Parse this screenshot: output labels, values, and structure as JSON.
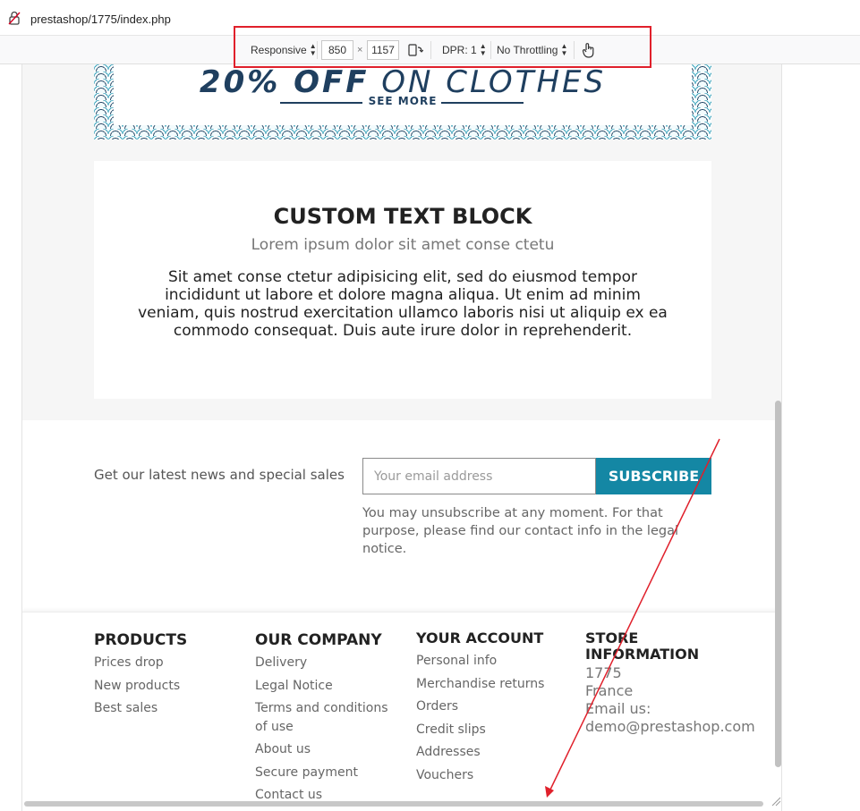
{
  "browser": {
    "url": "prestashop/1775/index.php"
  },
  "devtools": {
    "device": "Responsive",
    "width": "850",
    "times": "×",
    "height": "1157",
    "dpr": "DPR: 1",
    "throttling": "No Throttling"
  },
  "banner": {
    "title_bold": "20% OFF",
    "title_light": " ON CLOTHES",
    "see_more": "SEE MORE"
  },
  "custom_block": {
    "title": "CUSTOM TEXT BLOCK",
    "subtitle": "Lorem ipsum dolor sit amet conse ctetu",
    "body": "Sit amet conse ctetur adipisicing elit, sed do eiusmod tempor incididunt ut labore et dolore magna aliqua. Ut enim ad minim veniam, quis nostrud exercitation ullamco laboris nisi ut aliquip ex ea commodo consequat. Duis aute irure dolor in reprehenderit."
  },
  "newsletter": {
    "label": "Get our latest news and special sales",
    "placeholder": "Your email address",
    "button": "SUBSCRIBE",
    "note": "You may unsubscribe at any moment. For that purpose, please find our contact info in the legal notice."
  },
  "footer": {
    "products": {
      "title": "PRODUCTS",
      "links": [
        "Prices drop",
        "New products",
        "Best sales"
      ]
    },
    "company": {
      "title": "OUR COMPANY",
      "links": [
        "Delivery",
        "Legal Notice",
        "Terms and conditions of use",
        "About us",
        "Secure payment",
        "Contact us"
      ]
    },
    "account": {
      "title": "YOUR ACCOUNT",
      "links": [
        "Personal info",
        "Merchandise returns",
        "Orders",
        "Credit slips",
        "Addresses",
        "Vouchers"
      ]
    },
    "store": {
      "title": "STORE INFORMATION",
      "line1": "1775",
      "line2": "France",
      "line3": "Email us:",
      "line4": "demo@prestashop.com"
    }
  },
  "colors": {
    "accent": "#1487a4",
    "annotation": "#e0202b",
    "banner_text": "#1f3f5f"
  }
}
